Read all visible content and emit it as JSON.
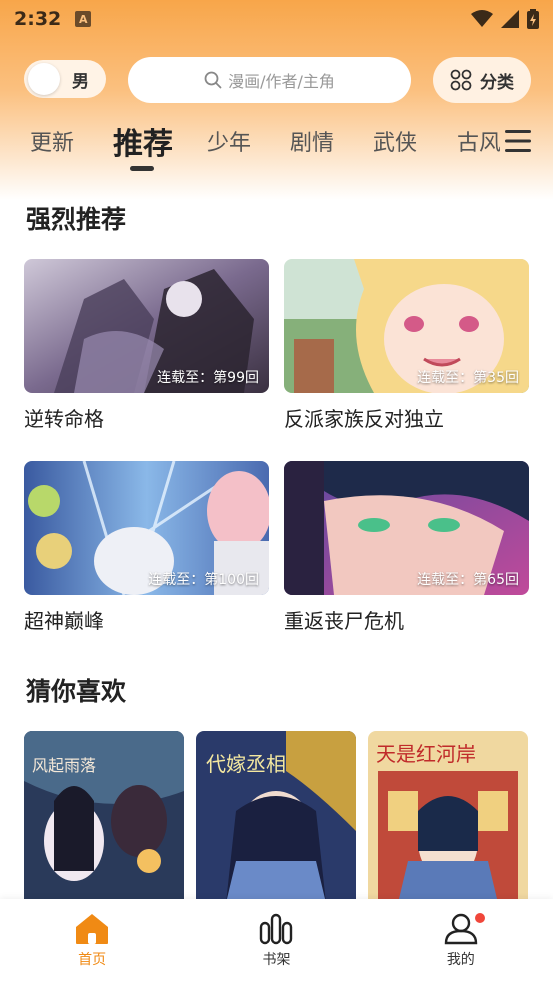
{
  "status_bar": {
    "time": "2:32",
    "notification_icon": "A"
  },
  "header": {
    "gender_label": "男",
    "search_placeholder": "漫画/作者/主角",
    "category_label": "分类"
  },
  "tabs": [
    {
      "label": "更新",
      "active": false
    },
    {
      "label": "推荐",
      "active": true
    },
    {
      "label": "少年",
      "active": false
    },
    {
      "label": "剧情",
      "active": false
    },
    {
      "label": "武侠",
      "active": false
    },
    {
      "label": "古风",
      "active": false
    }
  ],
  "featured": {
    "title": "强烈推荐",
    "items": [
      {
        "title": "逆转命格",
        "episode": "连载至：第99回"
      },
      {
        "title": "反派家族反对独立",
        "episode": "连载至：第35回"
      },
      {
        "title": "超神巅峰",
        "episode": "连载至：第100回"
      },
      {
        "title": "重返丧尸危机",
        "episode": "连载至：第65回"
      }
    ]
  },
  "guess": {
    "title": "猜你喜欢",
    "covers": [
      {
        "text": "风起雨落"
      },
      {
        "text": "代嫁丞相"
      },
      {
        "text": "天是红河岸"
      }
    ]
  },
  "bottom_nav": [
    {
      "label": "首页",
      "icon": "home-icon",
      "active": true
    },
    {
      "label": "书架",
      "icon": "bookshelf-icon",
      "active": false
    },
    {
      "label": "我的",
      "icon": "profile-icon",
      "active": false
    }
  ],
  "colors": {
    "accent": "#f08a14",
    "badge": "#f0463a"
  }
}
